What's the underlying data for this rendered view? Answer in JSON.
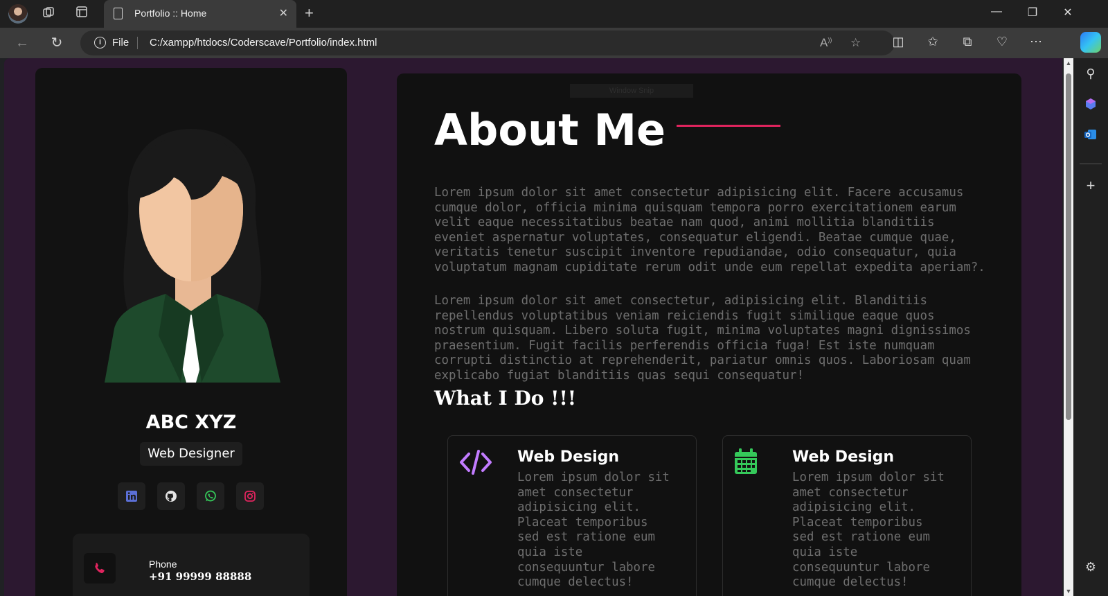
{
  "browser": {
    "tab_title": "Portfolio :: Home",
    "address_prefix": "File",
    "url": "C:/xampp/htdocs/Coderscave/Portfolio/index.html"
  },
  "profile": {
    "name": "ABC XYZ",
    "role": "Web Designer",
    "socials": [
      "linkedin-icon",
      "github-icon",
      "whatsapp-icon",
      "instagram-icon"
    ],
    "contact": {
      "label": "Phone",
      "value": "+91 99999 88888"
    }
  },
  "about": {
    "title": "About Me",
    "overlay_text": "Window Snip",
    "paragraphs": [
      "Lorem ipsum dolor sit amet consectetur adipisicing elit. Facere accusamus cumque dolor, officia minima quisquam tempora porro exercitationem earum velit eaque necessitatibus beatae nam quod, animi mollitia blanditiis eveniet aspernatur voluptates, consequatur eligendi. Beatae cumque quae, veritatis tenetur suscipit inventore repudiandae, odio consequatur, quia voluptatum magnam cupiditate rerum odit unde eum repellat expedita aperiam?.",
      "Lorem ipsum dolor sit amet consectetur, adipisicing elit. Blanditiis repellendus voluptatibus veniam reiciendis fugit similique eaque quos nostrum quisquam. Libero soluta fugit, minima voluptates magni dignissimos praesentium. Fugit facilis perferendis officia fuga! Est iste numquam corrupti distinctio at reprehenderit, pariatur omnis quos. Laboriosam quam explicabo fugiat blanditiis quas sequi consequatur!"
    ],
    "what_i_do": "What I Do !!!",
    "services": [
      {
        "icon": "code-icon",
        "title": "Web Design",
        "text": "Lorem ipsum dolor sit amet consectetur adipisicing elit. Placeat temporibus sed est ratione eum quia iste consequuntur labore cumque delectus!"
      },
      {
        "icon": "calendar-icon",
        "title": "Web Design",
        "text": "Lorem ipsum dolor sit amet consectetur adipisicing elit. Placeat temporibus sed est ratione eum quia iste consequuntur labore cumque delectus!"
      }
    ]
  },
  "colors": {
    "page_bg": "#2c1830",
    "card_bg": "#121212",
    "accent_line": "#e0245e",
    "code_icon": "#c27cff",
    "calendar_icon": "#35c95a",
    "phone_icon": "#e0245e",
    "linkedin": "#5b6fd6",
    "whatsapp": "#35c95a",
    "instagram": "#e0245e"
  }
}
